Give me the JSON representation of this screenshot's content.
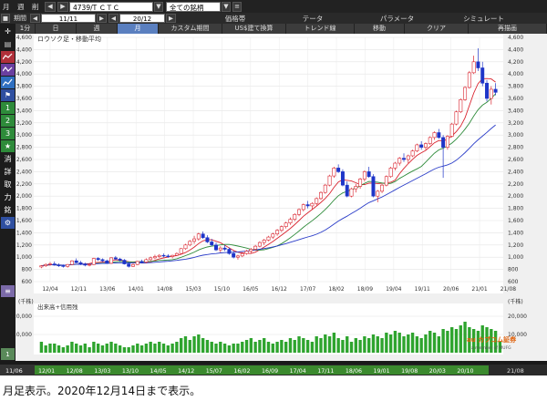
{
  "toolbar": {
    "mode_label": "月",
    "mode_label2": "週",
    "mode_label3": "削",
    "code_field": "4739/T ＣＴＣ",
    "dropdown": "全ての銘柄",
    "menus": [
      "価格帯",
      "テータ",
      "パラメータ",
      "シミュレート"
    ],
    "period_label": "期間",
    "from_date": "11/11",
    "to_date": "20/12",
    "row2_menus": [
      "価格帯",
      "テータ",
      "パラメータ",
      "シミュレート"
    ]
  },
  "tabs": [
    {
      "label": "1分"
    },
    {
      "label": "日"
    },
    {
      "label": "週"
    },
    {
      "label": "月",
      "active": true
    },
    {
      "label": "カスタム期間"
    },
    {
      "label": "US$建て換算"
    },
    {
      "label": "トレンド線"
    },
    {
      "label": "移動"
    },
    {
      "label": "クリア"
    },
    {
      "label": "再描画"
    }
  ],
  "sidebar": [
    "1",
    "2",
    "3",
    "★",
    "消",
    "詳",
    "取",
    "力",
    "銘"
  ],
  "chart": {
    "title": "ロウソク足・移動平均",
    "price_ticks": [
      "4,600",
      "4,400",
      "4,200",
      "4,000",
      "3,800",
      "3,600",
      "3,400",
      "3,200",
      "3,000",
      "2,800",
      "2,600",
      "2,400",
      "2,200",
      "2,000",
      "1,800",
      "1,600",
      "1,400",
      "1,200",
      "1,000",
      "800",
      "600"
    ],
    "x_labels": [
      "12/04",
      "12/11",
      "13/06",
      "14/01",
      "14/08",
      "15/03",
      "15/10",
      "16/05",
      "16/12",
      "17/07",
      "18/02",
      "18/09",
      "19/04",
      "19/11",
      "20/06",
      "21/01",
      "21/08"
    ],
    "volume_title": "出来高+信用残",
    "volume_unit": "(千株)",
    "volume_ticks": [
      "20,000",
      "10,000"
    ],
    "date_bar": [
      "12/01",
      "12/08",
      "13/03",
      "13/10",
      "14/05",
      "14/12",
      "15/07",
      "16/02",
      "16/09",
      "17/04",
      "17/11",
      "18/06",
      "19/01",
      "19/08",
      "20/03",
      "20/10"
    ],
    "date_bar_left": "11/06",
    "date_bar_right": "21/08",
    "logo": "au カブコム証券",
    "logo_sub": "a member of MUFG"
  },
  "chart_data": {
    "type": "candlestick",
    "ylim": [
      600,
      4600
    ],
    "price_candles": [
      [
        840,
        870,
        820,
        860
      ],
      [
        860,
        900,
        840,
        880
      ],
      [
        880,
        920,
        860,
        890
      ],
      [
        890,
        930,
        860,
        870
      ],
      [
        870,
        900,
        840,
        860
      ],
      [
        860,
        880,
        830,
        850
      ],
      [
        850,
        890,
        830,
        880
      ],
      [
        880,
        950,
        870,
        940
      ],
      [
        940,
        980,
        900,
        910
      ],
      [
        910,
        940,
        870,
        890
      ],
      [
        890,
        910,
        850,
        870
      ],
      [
        870,
        900,
        850,
        880
      ],
      [
        880,
        990,
        870,
        980
      ],
      [
        980,
        1000,
        940,
        960
      ],
      [
        960,
        980,
        920,
        940
      ],
      [
        940,
        960,
        890,
        900
      ],
      [
        900,
        1000,
        890,
        990
      ],
      [
        990,
        1020,
        950,
        970
      ],
      [
        970,
        990,
        930,
        950
      ],
      [
        950,
        970,
        880,
        890
      ],
      [
        890,
        920,
        830,
        850
      ],
      [
        850,
        900,
        840,
        880
      ],
      [
        880,
        940,
        870,
        930
      ],
      [
        930,
        960,
        900,
        920
      ],
      [
        920,
        980,
        900,
        960
      ],
      [
        960,
        1010,
        940,
        990
      ],
      [
        990,
        1040,
        970,
        1010
      ],
      [
        1010,
        1050,
        990,
        1030
      ],
      [
        1030,
        1060,
        1000,
        1020
      ],
      [
        1020,
        1050,
        990,
        1010
      ],
      [
        1010,
        1040,
        980,
        1030
      ],
      [
        1030,
        1080,
        1020,
        1060
      ],
      [
        1060,
        1150,
        1050,
        1140
      ],
      [
        1140,
        1220,
        1120,
        1200
      ],
      [
        1200,
        1280,
        1180,
        1260
      ],
      [
        1260,
        1350,
        1220,
        1300
      ],
      [
        1300,
        1400,
        1270,
        1380
      ],
      [
        1380,
        1420,
        1300,
        1320
      ],
      [
        1320,
        1360,
        1230,
        1250
      ],
      [
        1250,
        1300,
        1180,
        1200
      ],
      [
        1200,
        1240,
        1100,
        1120
      ],
      [
        1120,
        1180,
        1080,
        1150
      ],
      [
        1150,
        1200,
        1100,
        1130
      ],
      [
        1130,
        1160,
        1040,
        1060
      ],
      [
        1060,
        1100,
        980,
        1000
      ],
      [
        1000,
        1040,
        960,
        1020
      ],
      [
        1020,
        1080,
        1000,
        1060
      ],
      [
        1060,
        1120,
        1040,
        1100
      ],
      [
        1100,
        1150,
        1070,
        1130
      ],
      [
        1130,
        1200,
        1110,
        1180
      ],
      [
        1180,
        1260,
        1160,
        1240
      ],
      [
        1240,
        1300,
        1200,
        1280
      ],
      [
        1280,
        1350,
        1260,
        1330
      ],
      [
        1330,
        1400,
        1300,
        1380
      ],
      [
        1380,
        1460,
        1350,
        1440
      ],
      [
        1440,
        1520,
        1410,
        1500
      ],
      [
        1500,
        1580,
        1470,
        1560
      ],
      [
        1560,
        1650,
        1530,
        1620
      ],
      [
        1620,
        1720,
        1590,
        1700
      ],
      [
        1700,
        1800,
        1670,
        1780
      ],
      [
        1780,
        1880,
        1750,
        1860
      ],
      [
        1860,
        1920,
        1800,
        1840
      ],
      [
        1840,
        1900,
        1780,
        1880
      ],
      [
        1880,
        1980,
        1850,
        1960
      ],
      [
        1960,
        2080,
        1940,
        2060
      ],
      [
        2060,
        2200,
        2040,
        2180
      ],
      [
        2180,
        2350,
        2160,
        2330
      ],
      [
        2330,
        2480,
        2300,
        2460
      ],
      [
        2460,
        2520,
        2380,
        2400
      ],
      [
        2400,
        2440,
        2160,
        2180
      ],
      [
        2180,
        2240,
        1980,
        2000
      ],
      [
        2000,
        2140,
        1980,
        2120
      ],
      [
        2120,
        2200,
        2060,
        2160
      ],
      [
        2160,
        2300,
        2120,
        2280
      ],
      [
        2280,
        2420,
        2240,
        2400
      ],
      [
        2400,
        2480,
        2300,
        2320
      ],
      [
        2320,
        2360,
        1980,
        2000
      ],
      [
        2000,
        2100,
        1900,
        2080
      ],
      [
        2080,
        2200,
        2050,
        2180
      ],
      [
        2180,
        2340,
        2160,
        2320
      ],
      [
        2320,
        2480,
        2300,
        2460
      ],
      [
        2460,
        2560,
        2420,
        2540
      ],
      [
        2540,
        2640,
        2500,
        2620
      ],
      [
        2620,
        2700,
        2560,
        2600
      ],
      [
        2600,
        2680,
        2540,
        2660
      ],
      [
        2660,
        2760,
        2640,
        2740
      ],
      [
        2740,
        2860,
        2720,
        2840
      ],
      [
        2840,
        2900,
        2760,
        2800
      ],
      [
        2800,
        2880,
        2760,
        2860
      ],
      [
        2860,
        2980,
        2840,
        2960
      ],
      [
        2960,
        3060,
        2920,
        3040
      ],
      [
        3040,
        3100,
        2940,
        2960
      ],
      [
        2960,
        3000,
        2300,
        2800
      ],
      [
        2800,
        3000,
        2760,
        2980
      ],
      [
        2980,
        3200,
        2960,
        3180
      ],
      [
        3180,
        3400,
        3160,
        3380
      ],
      [
        3380,
        3600,
        3360,
        3580
      ],
      [
        3580,
        3800,
        3560,
        3780
      ],
      [
        3780,
        4050,
        3760,
        4020
      ],
      [
        4020,
        4300,
        4000,
        4200
      ],
      [
        4200,
        4420,
        4050,
        4100
      ],
      [
        4100,
        4200,
        3800,
        3850
      ],
      [
        3850,
        3900,
        3550,
        3600
      ],
      [
        3600,
        3800,
        3500,
        3750
      ],
      [
        3750,
        3850,
        3650,
        3700
      ]
    ],
    "volumes": [
      6,
      4,
      5,
      5,
      4,
      3,
      4,
      6,
      5,
      4,
      5,
      3,
      6,
      5,
      4,
      5,
      6,
      5,
      4,
      3,
      3,
      4,
      5,
      4,
      5,
      6,
      5,
      6,
      5,
      4,
      5,
      6,
      8,
      9,
      7,
      9,
      10,
      8,
      7,
      6,
      5,
      6,
      5,
      4,
      5,
      5,
      6,
      7,
      8,
      6,
      7,
      8,
      6,
      5,
      6,
      7,
      6,
      8,
      7,
      9,
      8,
      7,
      6,
      9,
      8,
      10,
      9,
      11,
      8,
      7,
      9,
      6,
      8,
      7,
      9,
      8,
      10,
      9,
      8,
      11,
      10,
      12,
      11,
      9,
      10,
      11,
      9,
      8,
      10,
      12,
      11,
      9,
      13,
      12,
      14,
      13,
      15,
      17,
      14,
      13,
      12,
      15,
      14,
      13,
      12,
      6
    ]
  }
}
